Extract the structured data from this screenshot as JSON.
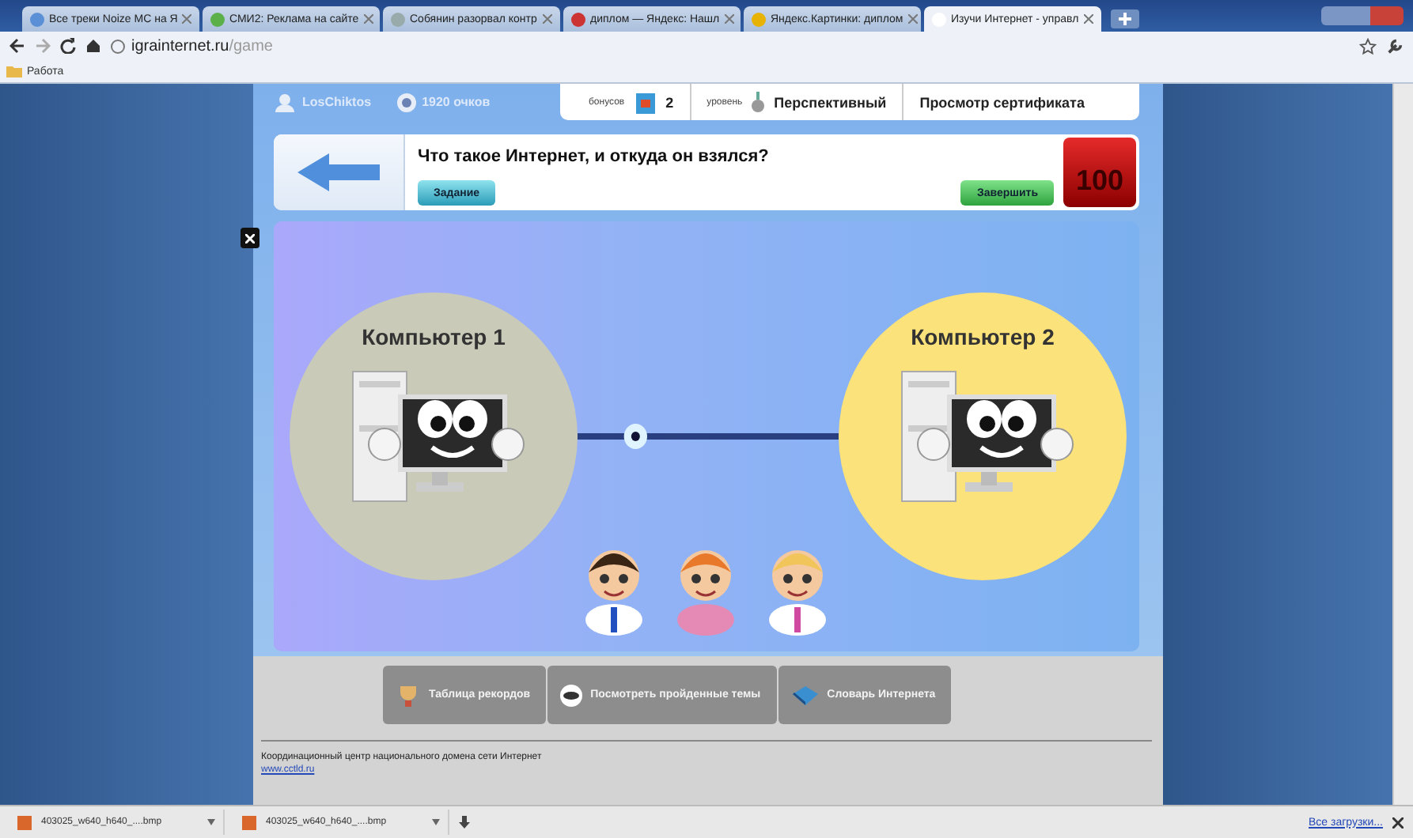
{
  "browser": {
    "tabs": [
      {
        "title": "Все треки Noize MC на Я",
        "selected": false
      },
      {
        "title": "СМИ2: Реклама на сайте",
        "selected": false
      },
      {
        "title": "Собянин разорвал контр",
        "selected": false
      },
      {
        "title": "диплом — Яндекс: Нашл",
        "selected": false
      },
      {
        "title": "Яндекс.Картинки: диплом",
        "selected": false
      },
      {
        "title": "Изучи Интернет - управл",
        "selected": true
      }
    ],
    "url": {
      "host": "igrainternet.ru",
      "path": "/game"
    },
    "bookmarks": [
      "Работа"
    ]
  },
  "game": {
    "player": "LosChiktos",
    "score": "1920 очков",
    "bonus_label": "бонусов",
    "bonus_count": "2",
    "rank_label": "уровень",
    "rank": "Перспективный",
    "certificate": "Просмотр сертификата",
    "question": "Что такое Интернет, и откуда он взялся?",
    "task_button": "Задание",
    "finish_button": "Завершить",
    "timer": "100",
    "computers": [
      {
        "label": "Компьютер 1",
        "color": "#c9cbb8"
      },
      {
        "label": "Компьютер 2",
        "color": "#fbe27a"
      }
    ],
    "menu": [
      "Таблица рекордов",
      "Посмотреть пройденные темы",
      "Словарь Интернета"
    ],
    "footer": {
      "text": "Координационный центр национального домена сети Интернет",
      "link": "www.cctld.ru"
    }
  },
  "downloads": {
    "items": [
      "403025_w640_h640_....bmp",
      "403025_w640_h640_....bmp"
    ],
    "all": "Все загрузки..."
  }
}
